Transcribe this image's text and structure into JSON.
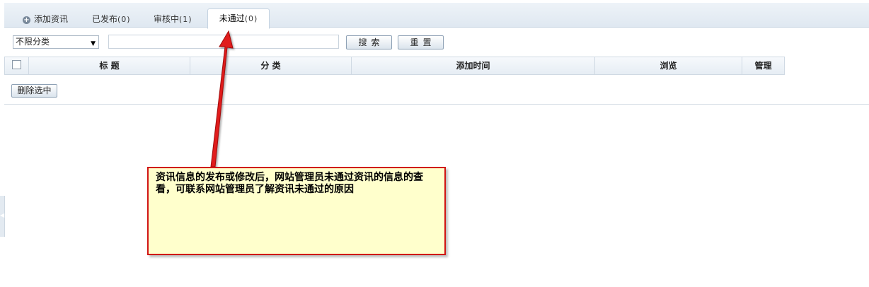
{
  "tabs": {
    "add": {
      "label": "添加资讯"
    },
    "published": {
      "label": "已发布",
      "count": "(0)"
    },
    "review": {
      "label": "审核中",
      "count": "(1)"
    },
    "failed": {
      "label": "未通过",
      "count": "(0)"
    }
  },
  "filter": {
    "category_selected": "不限分类",
    "search_value": "",
    "search_button": "搜索",
    "reset_button": "重置"
  },
  "table": {
    "columns": [
      "标 题",
      "分 类",
      "添加时间",
      "浏览",
      "管理"
    ],
    "rows": []
  },
  "actions": {
    "delete_selected": "删除选中"
  },
  "annotation": {
    "text": "资讯信息的发布或修改后，网站管理员未通过资讯的信息的查看，可联系网站管理员了解资讯未通过的原因",
    "border_color": "#d01414",
    "background_color": "#ffffcc",
    "arrow_color": "#d01414"
  },
  "icons": {
    "add_tab_icon": "plus-circle",
    "select_caret": "triangle-down",
    "side_handle": "triangle-left"
  }
}
